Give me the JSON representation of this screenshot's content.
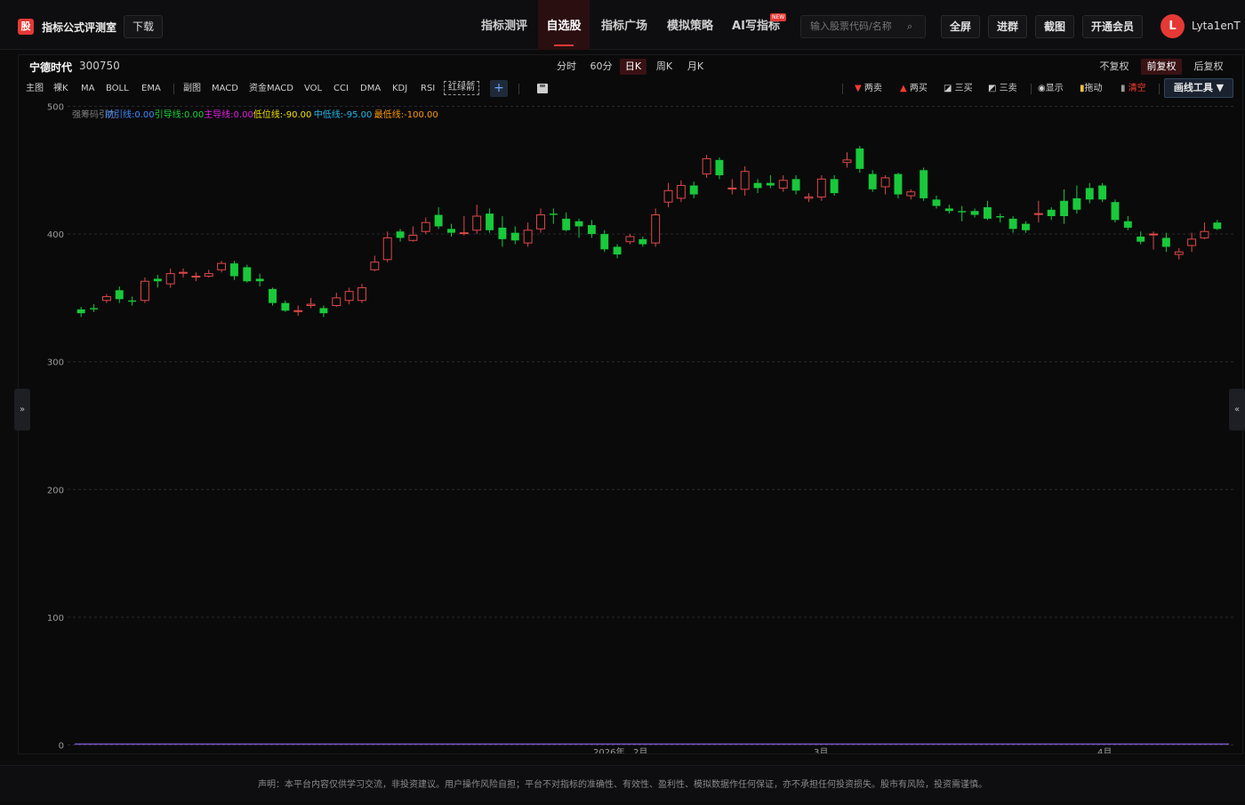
{
  "header": {
    "logo_char": "股",
    "brand": "指标公式评测室",
    "download": "下载",
    "nav": [
      "指标测评",
      "自选股",
      "指标广场",
      "模拟策略",
      "AI写指标"
    ],
    "nav_active": 1,
    "new_badge": "NEW",
    "search_placeholder": "输入股票代码/名称",
    "buttons": [
      "全屏",
      "进群",
      "截图",
      "开通会员"
    ],
    "avatar_letter": "L",
    "username": "Lyta1enT"
  },
  "stock": {
    "name": "宁德时代",
    "code": "300750"
  },
  "periods": [
    "分时",
    "60分",
    "日K",
    "周K",
    "月K"
  ],
  "period_active": 2,
  "adjust": [
    "不复权",
    "前复权",
    "后复权"
  ],
  "adjust_active": 1,
  "indicators_main": [
    "主图",
    "裸K",
    "MA",
    "BOLL",
    "EMA"
  ],
  "indicators_sub": [
    "副图",
    "MACD",
    "资金MACD",
    "VOL",
    "CCI",
    "DMA",
    "KDJ",
    "RSI"
  ],
  "indicator_boxed": "红绿箭",
  "plus": "+",
  "tools": [
    {
      "icon": "▼",
      "label": "两卖",
      "color": "#ff3b30"
    },
    {
      "icon": "▲",
      "label": "两买",
      "color": "#ff3b30"
    },
    {
      "icon": "◪",
      "label": "三买",
      "color": "#cfcfcf"
    },
    {
      "icon": "◩",
      "label": "三卖",
      "color": "#cfcfcf"
    },
    {
      "icon": "◉",
      "label": "显示",
      "color": "#cfcfcf"
    },
    {
      "icon": "▮",
      "label": "拖动",
      "color": "#f0c040"
    },
    {
      "icon": "▮",
      "label": "清空",
      "color": "#ff3b30"
    }
  ],
  "draw_tool": "画线工具 ▼",
  "side_left": "»",
  "side_right": "«",
  "legend": [
    {
      "text": "强筹码引力",
      "color": "#7d7d7d"
    },
    {
      "text": "前引线:0.00",
      "color": "#3d8bff"
    },
    {
      "text": "引导线:0.00",
      "color": "#19d339"
    },
    {
      "text": "主导线:0.00",
      "color": "#e020e0"
    },
    {
      "text": "低位线:-90.00",
      "color": "#f0e000"
    },
    {
      "text": "中低线:-95.00",
      "color": "#22b8e8"
    },
    {
      "text": "最低线:-100.00",
      "color": "#ff9a00"
    }
  ],
  "chart_data": {
    "type": "candlestick",
    "y_ticks": [
      0,
      100,
      200,
      300,
      400,
      500
    ],
    "ylim": [
      0,
      500
    ],
    "x_labels": [
      "2026年",
      "2月",
      "3月",
      "4月"
    ],
    "up_color": "#e04848",
    "down_color": "#19c93a",
    "candles": [
      [
        341,
        338,
        343,
        335
      ],
      [
        342,
        341,
        345,
        339
      ],
      [
        348,
        351,
        353,
        346
      ],
      [
        356,
        349,
        359,
        346
      ],
      [
        348,
        347,
        351,
        344
      ],
      [
        348,
        363,
        366,
        346
      ],
      [
        365,
        363,
        368,
        358
      ],
      [
        361,
        369,
        373,
        358
      ],
      [
        370,
        370,
        373,
        366
      ],
      [
        367,
        367,
        370,
        363
      ],
      [
        367,
        369,
        372,
        366
      ],
      [
        372,
        377,
        379,
        370
      ],
      [
        377,
        367,
        379,
        364
      ],
      [
        374,
        363,
        376,
        362
      ],
      [
        365,
        363,
        369,
        359
      ],
      [
        357,
        346,
        358,
        344
      ],
      [
        346,
        340,
        348,
        339
      ],
      [
        340,
        340,
        344,
        336
      ],
      [
        344,
        345,
        350,
        342
      ],
      [
        342,
        338,
        344,
        335
      ],
      [
        344,
        350,
        354,
        343
      ],
      [
        348,
        355,
        358,
        345
      ],
      [
        348,
        358,
        361,
        346
      ],
      [
        372,
        378,
        383,
        371
      ],
      [
        380,
        397,
        402,
        378
      ],
      [
        402,
        397,
        404,
        394
      ],
      [
        395,
        399,
        406,
        394
      ],
      [
        402,
        409,
        413,
        400
      ],
      [
        415,
        406,
        421,
        404
      ],
      [
        404,
        401,
        408,
        398
      ],
      [
        401,
        401,
        414,
        399
      ],
      [
        403,
        414,
        423,
        400
      ],
      [
        416,
        403,
        420,
        401
      ],
      [
        405,
        396,
        414,
        390
      ],
      [
        401,
        395,
        406,
        392
      ],
      [
        393,
        403,
        409,
        390
      ],
      [
        404,
        415,
        420,
        401
      ],
      [
        416,
        415,
        420,
        408
      ],
      [
        412,
        403,
        417,
        402
      ],
      [
        410,
        406,
        412,
        397
      ],
      [
        407,
        400,
        411,
        397
      ],
      [
        400,
        388,
        403,
        386
      ],
      [
        390,
        384,
        392,
        381
      ],
      [
        394,
        398,
        400,
        392
      ],
      [
        396,
        392,
        398,
        390
      ],
      [
        393,
        415,
        420,
        390
      ],
      [
        425,
        434,
        440,
        421
      ],
      [
        428,
        438,
        442,
        425
      ],
      [
        438,
        431,
        441,
        428
      ],
      [
        447,
        459,
        462,
        444
      ],
      [
        458,
        446,
        460,
        443
      ],
      [
        436,
        436,
        443,
        431
      ],
      [
        435,
        449,
        453,
        430
      ],
      [
        440,
        436,
        443,
        432
      ],
      [
        440,
        438,
        446,
        436
      ],
      [
        436,
        442,
        446,
        433
      ],
      [
        443,
        434,
        446,
        431
      ],
      [
        428,
        429,
        432,
        425
      ],
      [
        429,
        443,
        446,
        426
      ],
      [
        443,
        432,
        446,
        430
      ],
      [
        456,
        458,
        464,
        452
      ],
      [
        467,
        451,
        469,
        448
      ],
      [
        447,
        435,
        450,
        433
      ],
      [
        437,
        444,
        446,
        431
      ],
      [
        447,
        431,
        448,
        428
      ],
      [
        430,
        433,
        435,
        427
      ],
      [
        450,
        428,
        452,
        426
      ],
      [
        427,
        422,
        430,
        420
      ],
      [
        420,
        418,
        423,
        416
      ],
      [
        418,
        417,
        422,
        410
      ],
      [
        418,
        415,
        420,
        413
      ],
      [
        421,
        412,
        426,
        411
      ],
      [
        414,
        413,
        416,
        409
      ],
      [
        412,
        404,
        414,
        401
      ],
      [
        408,
        403,
        410,
        401
      ],
      [
        416,
        416,
        426,
        409
      ],
      [
        419,
        414,
        421,
        411
      ],
      [
        426,
        414,
        435,
        408
      ],
      [
        428,
        419,
        438,
        416
      ],
      [
        436,
        427,
        440,
        424
      ],
      [
        438,
        427,
        440,
        425
      ],
      [
        425,
        411,
        427,
        409
      ],
      [
        410,
        405,
        414,
        403
      ],
      [
        398,
        394,
        402,
        392
      ],
      [
        400,
        400,
        402,
        388
      ],
      [
        397,
        390,
        401,
        386
      ],
      [
        384,
        386,
        389,
        380
      ],
      [
        391,
        396,
        401,
        386
      ],
      [
        397,
        402,
        409,
        396
      ],
      [
        409,
        404,
        411,
        403
      ]
    ]
  },
  "footer": "声明：本平台内容仅供学习交流，非投资建议。用户操作风险自担；平台不对指标的准确性、有效性、盈利性、模拟数据作任何保证，亦不承担任何投资损失。股市有风险，投资需谨慎。"
}
